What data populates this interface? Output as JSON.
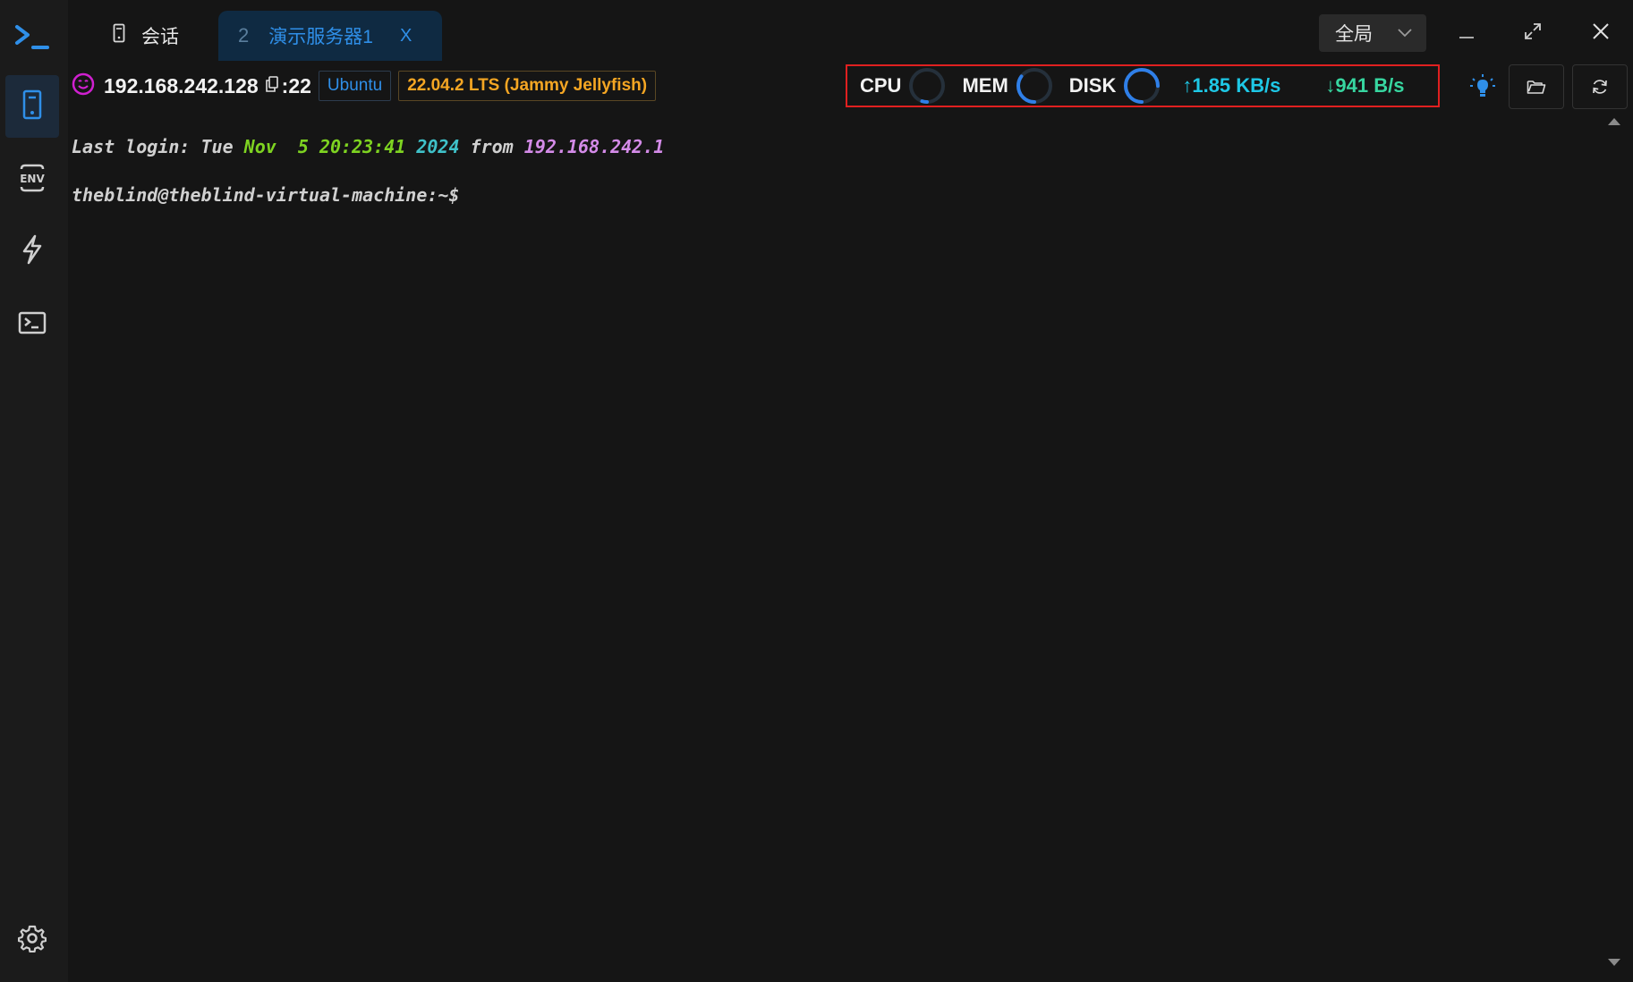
{
  "app": {
    "title": ""
  },
  "tabs": {
    "session_label": "会话",
    "active": {
      "number": "2",
      "title": "演示服务器1",
      "close": "X"
    }
  },
  "scope": {
    "label": "全局"
  },
  "host": {
    "ip": "192.168.242.128",
    "port": ":22",
    "os": "Ubuntu",
    "version": "22.04.2 LTS (Jammy Jellyfish)"
  },
  "monitor": {
    "cpu_label": "CPU",
    "mem_label": "MEM",
    "disk_label": "DISK",
    "cpu_ring": 0.05,
    "mem_ring": 0.35,
    "disk_ring": 0.75,
    "upload": "↑1.85 KB/s",
    "download": "↓941 B/s",
    "colors": {
      "ring": "#2f7fe8",
      "upload": "#1ec8e6",
      "download": "#37d6a0",
      "alert_border": "#e02020"
    }
  },
  "terminal": {
    "line1": {
      "prefix": "Last login: Tue ",
      "month": "Nov",
      "daytime": "  5 20:23:41",
      "year": " 2024",
      "from": " from ",
      "ip": "192.168.242.1"
    },
    "line2": "theblind@theblind-virtual-machine:~$"
  },
  "icons": {
    "logo": "terminal-prompt-logo",
    "sidebar": [
      "server-icon",
      "env-icon",
      "lightning-icon",
      "terminal-icon",
      "gear-icon"
    ],
    "right": [
      "bulb-icon",
      "folder-icon",
      "refresh-icon"
    ]
  }
}
